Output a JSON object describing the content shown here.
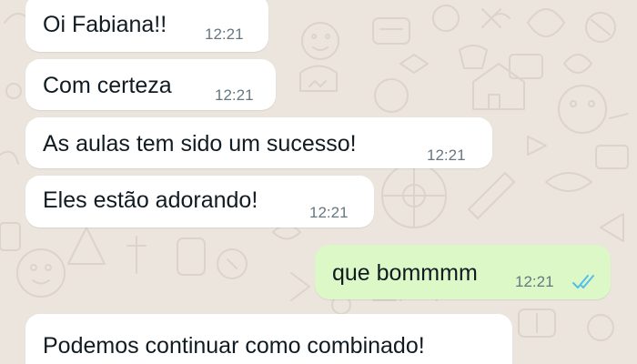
{
  "chat": {
    "messages": [
      {
        "direction": "incoming",
        "text": "Oi Fabiana!!",
        "time": "12:21"
      },
      {
        "direction": "incoming",
        "text": "Com certeza",
        "time": "12:21"
      },
      {
        "direction": "incoming",
        "text": "As aulas tem sido um sucesso!",
        "time": "12:21"
      },
      {
        "direction": "incoming",
        "text": "Eles estão adorando!",
        "time": "12:21"
      },
      {
        "direction": "outgoing",
        "text": "que bommmm",
        "time": "12:21",
        "status": "read-double-check-icon"
      },
      {
        "direction": "incoming",
        "text": "Podemos continuar como combinado!",
        "time": ""
      }
    ]
  },
  "colors": {
    "wallpaper": "#ece5dd",
    "incoming_bubble": "#ffffff",
    "outgoing_bubble": "#dcf8c6",
    "timestamp": "#667781",
    "read_ticks": "#53bdeb"
  }
}
